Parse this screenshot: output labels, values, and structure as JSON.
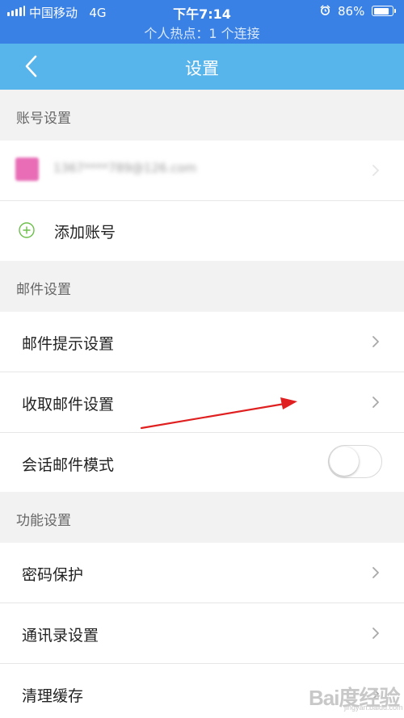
{
  "status_bar": {
    "carrier": "中国移动",
    "network": "4G",
    "time": "下午7:14",
    "battery": "86%",
    "battery_level": 0.86,
    "hotspot": "个人热点：1 个连接"
  },
  "nav": {
    "title": "设置",
    "back_icon": "chevron-left-icon"
  },
  "sections": {
    "account": {
      "header": "账号设置",
      "account_email": "1367****789@126.com",
      "add_account": "添加账号"
    },
    "mail": {
      "header": "邮件设置",
      "notify": "邮件提示设置",
      "receive": "收取邮件设置",
      "conversation": "会话邮件模式",
      "conversation_enabled": false
    },
    "features": {
      "header": "功能设置",
      "password": "密码保护",
      "contacts": "通讯录设置",
      "cache": "清理缓存"
    }
  },
  "watermark": {
    "text": "Bai度经验",
    "url": "jingyan.baidu.com"
  },
  "colors": {
    "status_bg": "#3a81e6",
    "nav_bg": "#58b5ec",
    "annotation_arrow": "#e02020"
  }
}
